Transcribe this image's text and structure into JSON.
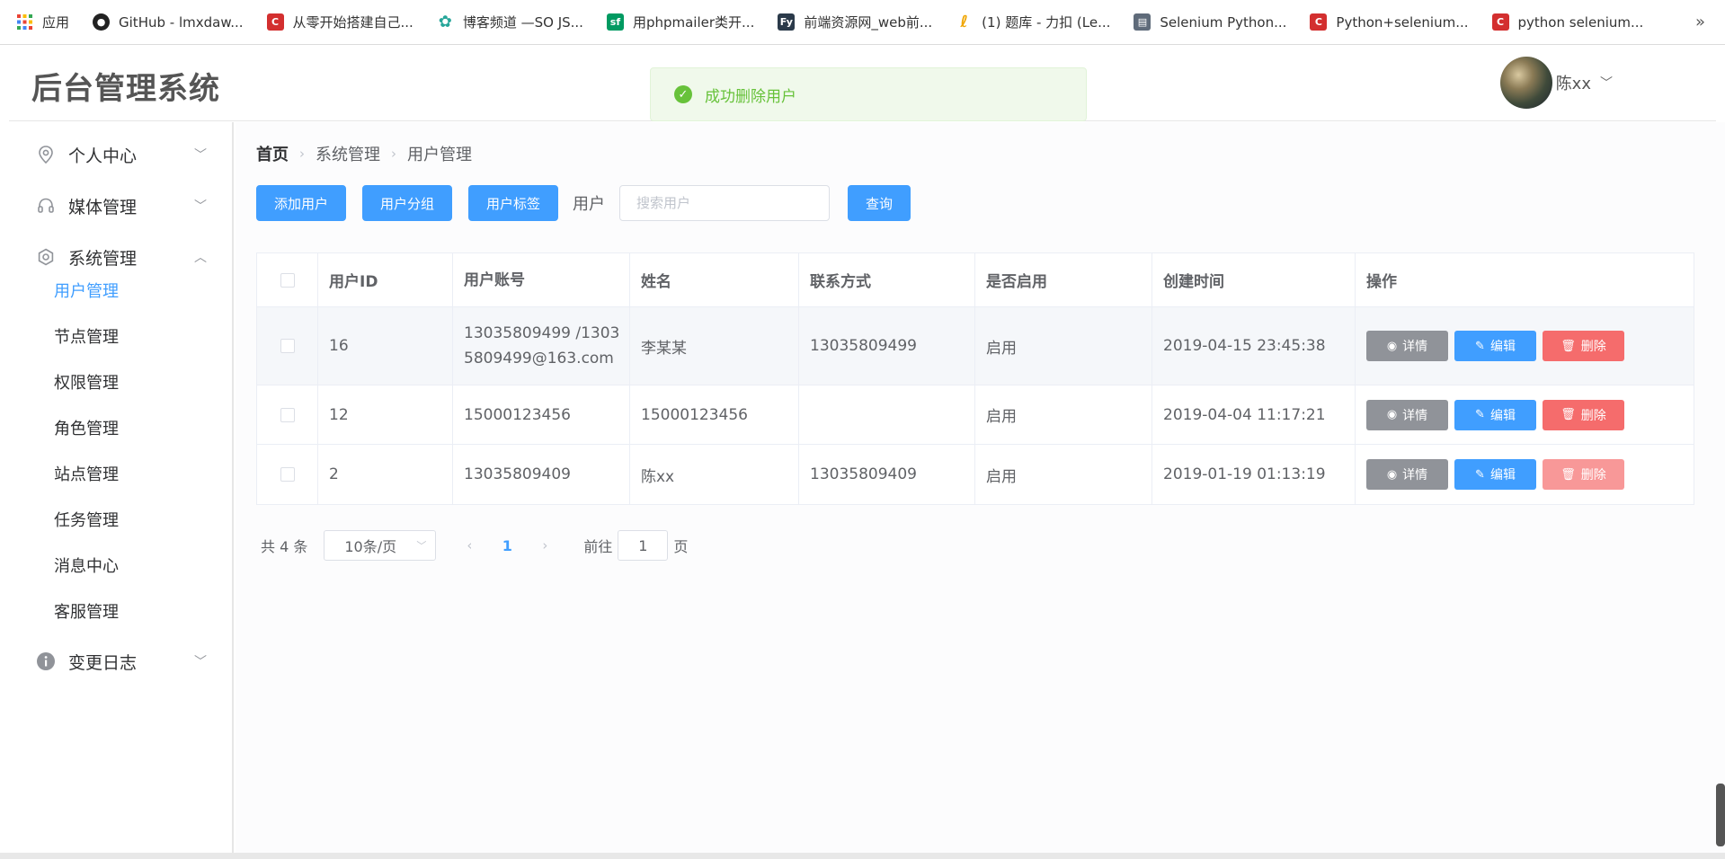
{
  "bookmarks": [
    {
      "label": "应用",
      "icon": "apps-grid-icon",
      "color": "#e53935"
    },
    {
      "label": "GitHub - lmxdaw...",
      "icon": "github-icon",
      "color": "#222222"
    },
    {
      "label": "从零开始搭建自己...",
      "icon": "csdn-icon",
      "color": "#d32f2f"
    },
    {
      "label": "博客频道 —SO JS...",
      "icon": "gear-flower-icon",
      "color": "#26a69a"
    },
    {
      "label": "用phpmailer类开...",
      "icon": "sf-icon",
      "color": "#009a61"
    },
    {
      "label": "前端资源网_web前...",
      "icon": "fy-icon",
      "color": "#2b3a4a"
    },
    {
      "label": "(1) 题库 - 力扣 (Le...",
      "icon": "leetcode-icon",
      "color": "#f0a500"
    },
    {
      "label": "Selenium Python...",
      "icon": "doc-icon",
      "color": "#5f6b7a"
    },
    {
      "label": "Python+selenium...",
      "icon": "csdn-icon",
      "color": "#d32f2f"
    },
    {
      "label": "python selenium...",
      "icon": "csdn-icon",
      "color": "#d32f2f"
    }
  ],
  "bookmarks_more": "»",
  "header": {
    "logo": "后台管理系统",
    "toast": "成功删除用户",
    "username": "陈xx"
  },
  "sidebar": {
    "menu": [
      {
        "label": "个人中心",
        "icon": "location-icon",
        "expanded": false
      },
      {
        "label": "媒体管理",
        "icon": "headset-icon",
        "expanded": false
      },
      {
        "label": "系统管理",
        "icon": "settings-icon",
        "expanded": true
      }
    ],
    "sub_items": [
      "用户管理",
      "节点管理",
      "权限管理",
      "角色管理",
      "站点管理",
      "任务管理",
      "消息中心",
      "客服管理"
    ],
    "active_sub": "用户管理",
    "log_item": {
      "label": "变更日志",
      "icon": "info-icon"
    }
  },
  "breadcrumb": [
    "首页",
    "系统管理",
    "用户管理"
  ],
  "toolbar": {
    "add_user": "添加用户",
    "user_group": "用户分组",
    "user_tag": "用户标签",
    "search_label": "用户",
    "search_placeholder": "搜索用户",
    "search_value": "",
    "query": "查询"
  },
  "table": {
    "headers": [
      "",
      "用户ID",
      "用户账号",
      "姓名",
      "联系方式",
      "是否启用",
      "创建时间",
      "操作"
    ],
    "rows": [
      {
        "id": "16",
        "account": "13035809499 /13035809499@163.com",
        "name": "李某某",
        "contact": "13035809499",
        "enabled": "启用",
        "created": "2019-04-15 23:45:38"
      },
      {
        "id": "12",
        "account": "15000123456",
        "name": "15000123456",
        "contact": "",
        "enabled": "启用",
        "created": "2019-04-04 11:17:21"
      },
      {
        "id": "2",
        "account": "13035809409",
        "name": "陈xx",
        "contact": "13035809409",
        "enabled": "启用",
        "created": "2019-01-19 01:13:19"
      }
    ],
    "actions": {
      "detail": "详情",
      "edit": "编辑",
      "delete": "删除"
    }
  },
  "pagination": {
    "total": "共 4 条",
    "page_size": "10条/页",
    "current_page": "1",
    "goto_label": "前往",
    "goto_value": "1",
    "page_suffix": "页"
  },
  "colors": {
    "primary": "#409eff",
    "success": "#67c23a",
    "danger": "#f56c6c",
    "info": "#909399"
  }
}
